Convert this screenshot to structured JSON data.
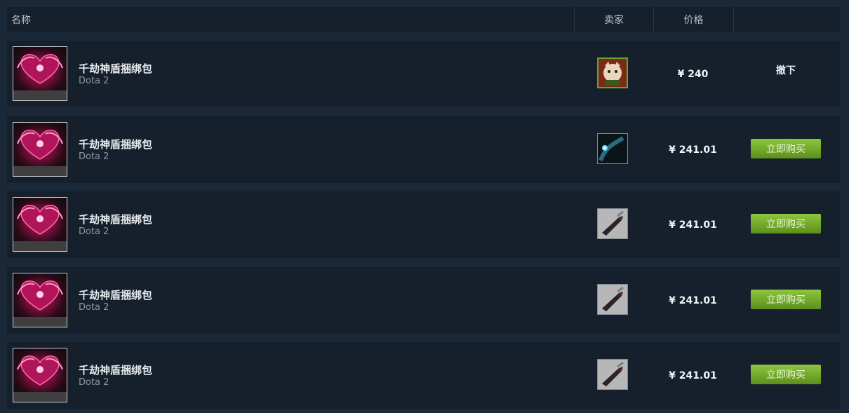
{
  "header": {
    "name": "名称",
    "seller": "卖家",
    "price": "价格"
  },
  "rows": [
    {
      "name": "千劫神盾捆绑包",
      "game": "Dota 2",
      "seller_avatar": "cat-avatar",
      "price": "¥ 240",
      "action": "撤下",
      "action_type": "remove"
    },
    {
      "name": "千劫神盾捆绑包",
      "game": "Dota 2",
      "seller_avatar": "dark-cyan-avatar",
      "price": "¥ 241.01",
      "action": "立即购买",
      "action_type": "buy"
    },
    {
      "name": "千劫神盾捆绑包",
      "game": "Dota 2",
      "seller_avatar": "dagger-avatar",
      "price": "¥ 241.01",
      "action": "立即购买",
      "action_type": "buy"
    },
    {
      "name": "千劫神盾捆绑包",
      "game": "Dota 2",
      "seller_avatar": "dagger-avatar",
      "price": "¥ 241.01",
      "action": "立即购买",
      "action_type": "buy"
    },
    {
      "name": "千劫神盾捆绑包",
      "game": "Dota 2",
      "seller_avatar": "dagger-avatar",
      "price": "¥ 241.01",
      "action": "立即购买",
      "action_type": "buy"
    }
  ],
  "colors": {
    "background": "#1b2838",
    "row": "#16202d",
    "buy_green": "#8dc63f"
  }
}
